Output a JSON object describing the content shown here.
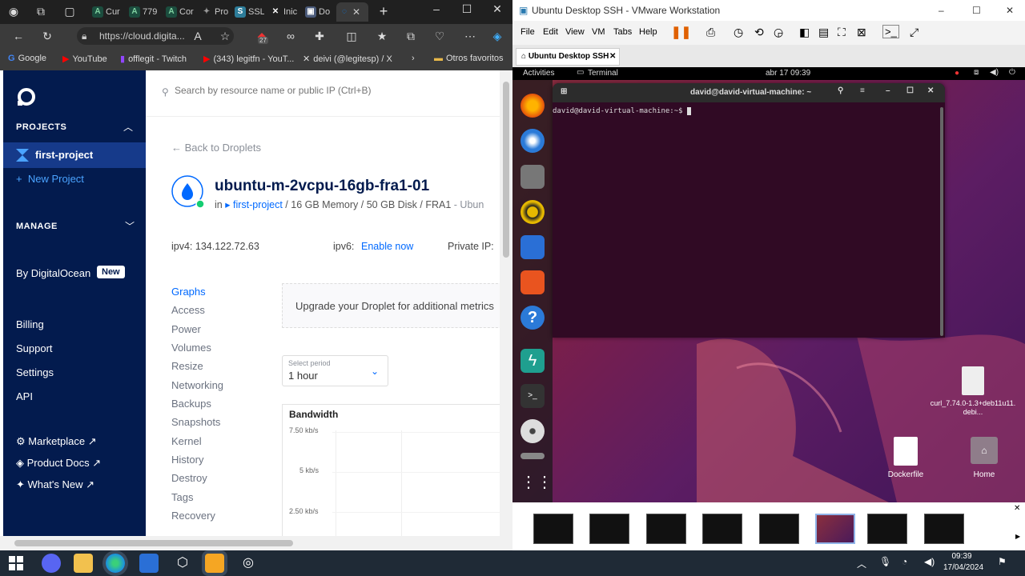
{
  "browser": {
    "tabs": [
      {
        "label": "Cur"
      },
      {
        "label": "779"
      },
      {
        "label": "Cor"
      },
      {
        "label": "Pro"
      },
      {
        "label": "SSL"
      },
      {
        "label": "Inic"
      },
      {
        "label": "Do"
      }
    ],
    "url": "https://cloud.digita...",
    "badge_count": "27",
    "favorites": [
      {
        "label": "Google"
      },
      {
        "label": "YouTube"
      },
      {
        "label": "offlegit - Twitch"
      },
      {
        "label": "(343) legitfn - YouT..."
      },
      {
        "label": "deivi (@legitesp) / X"
      },
      {
        "label": "Otros favoritos"
      }
    ]
  },
  "sidebar": {
    "projects_header": "PROJECTS",
    "project": "first-project",
    "new_project": "New Project",
    "manage_header": "MANAGE",
    "by_do": "By DigitalOcean",
    "new_badge": "New",
    "links": [
      "Billing",
      "Support",
      "Settings",
      "API"
    ],
    "ext_links": [
      "Marketplace ↗",
      "Product Docs ↗",
      "What's New ↗"
    ]
  },
  "main": {
    "search_placeholder": "Search by resource name or public IP (Ctrl+B)",
    "back": "← Back to Droplets",
    "droplet_name": "ubuntu-m-2vcpu-16gb-fra1-01",
    "in": "in",
    "project": "first-project",
    "specs": "/ 16 GB Memory / 50 GB Disk / FRA1",
    "os_suffix": "- Ubun",
    "ipv4": "ipv4: 134.122.72.63",
    "ipv6_label": "ipv6:",
    "ipv6_link": "Enable now",
    "private_ip": "Private IP:",
    "nav": [
      "Graphs",
      "Access",
      "Power",
      "Volumes",
      "Resize",
      "Networking",
      "Backups",
      "Snapshots",
      "Kernel",
      "History",
      "Destroy",
      "Tags",
      "Recovery"
    ],
    "upgrade": "Upgrade your Droplet for additional metrics",
    "period_label": "Select period",
    "period_value": "1 hour",
    "chart_title": "Bandwidth",
    "y_ticks": [
      "7.50 kb/s",
      "5 kb/s",
      "2.50 kb/s"
    ]
  },
  "vmware": {
    "title": "Ubuntu Desktop SSH - VMware Workstation",
    "menu": [
      "File",
      "Edit",
      "View",
      "VM",
      "Tabs",
      "Help"
    ],
    "tab": "Ubuntu Desktop SSH",
    "gnome_activities": "Activities",
    "gnome_app": "Terminal",
    "gnome_clock": "abr 17  09:39",
    "terminal_title": "david@david-virtual-machine: ~",
    "prompt": "david@david-virtual-machine:~$ ",
    "desktop_files": [
      {
        "name": "curl_7.74.0-1.3+deb11u11.debi..."
      },
      {
        "name": "Dockerfile"
      },
      {
        "name": "Home"
      }
    ]
  },
  "taskbar": {
    "time": "09:39",
    "date": "17/04/2024"
  }
}
